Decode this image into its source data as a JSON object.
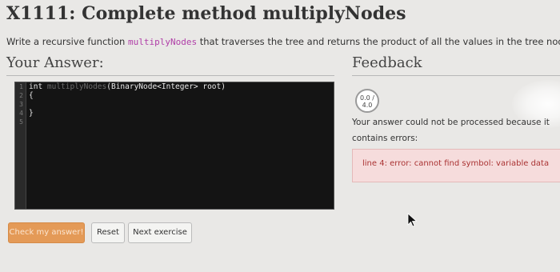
{
  "title": "X1111: Complete method multiplyNodes",
  "description": {
    "before": "Write a recursive function ",
    "code": "multiplyNodes",
    "after": " that traverses the tree and returns the product of all the values in the tree nodes."
  },
  "answer_heading": "Your Answer:",
  "feedback_heading": "Feedback",
  "editor": {
    "line_numbers": [
      "1",
      "2",
      "3",
      "4",
      "5"
    ],
    "lines": [
      {
        "pre": "int ",
        "fn": "multiplyNodes",
        "post": "(BinaryNode<Integer> root)"
      },
      {
        "pre": "{",
        "fn": "",
        "post": ""
      },
      {
        "pre": "",
        "fn": "",
        "post": ""
      },
      {
        "pre": "}",
        "fn": "",
        "post": ""
      },
      {
        "pre": "",
        "fn": "",
        "post": ""
      }
    ]
  },
  "buttons": {
    "check": "Check my answer!",
    "reset": "Reset",
    "next": "Next exercise"
  },
  "feedback": {
    "score_line1": "0.0 /",
    "score_line2": "4.0",
    "message": "Your answer could not be processed because it contains errors:",
    "error": "line 4: error: cannot find symbol: variable data"
  },
  "colors": {
    "check_button": "#e49a57",
    "error_bg": "#f6dcdc",
    "error_text": "#aa3333",
    "editor_bg": "#141414"
  }
}
